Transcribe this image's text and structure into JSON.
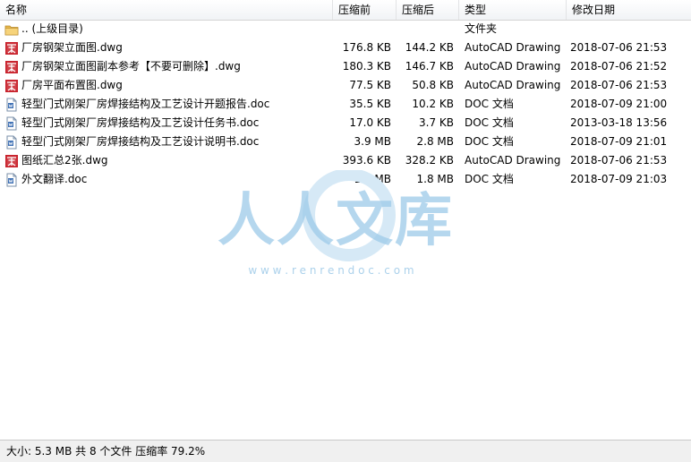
{
  "columns": {
    "name": "名称",
    "original_size": "压缩前",
    "compressed_size": "压缩后",
    "type": "类型",
    "modified": "修改日期"
  },
  "rows": [
    {
      "icon": "folder-icon",
      "name": ".. (上级目录)",
      "original": "",
      "compressed": "",
      "type": "文件夹",
      "date": ""
    },
    {
      "icon": "dwg-file-icon",
      "name": "厂房钢架立面图.dwg",
      "original": "176.8 KB",
      "compressed": "144.2 KB",
      "type": "AutoCAD Drawing",
      "date": "2018-07-06 21:53"
    },
    {
      "icon": "dwg-file-icon",
      "name": "厂房钢架立面图副本参考【不要可删除】.dwg",
      "original": "180.3 KB",
      "compressed": "146.7 KB",
      "type": "AutoCAD Drawing",
      "date": "2018-07-06 21:52"
    },
    {
      "icon": "dwg-file-icon",
      "name": "厂房平面布置图.dwg",
      "original": "77.5 KB",
      "compressed": "50.8 KB",
      "type": "AutoCAD Drawing",
      "date": "2018-07-06 21:53"
    },
    {
      "icon": "doc-file-icon",
      "name": "轻型门式刚架厂房焊接结构及工艺设计开题报告.doc",
      "original": "35.5 KB",
      "compressed": "10.2 KB",
      "type": "DOC 文档",
      "date": "2018-07-09 21:00"
    },
    {
      "icon": "doc-file-icon",
      "name": "轻型门式刚架厂房焊接结构及工艺设计任务书.doc",
      "original": "17.0 KB",
      "compressed": "3.7 KB",
      "type": "DOC 文档",
      "date": "2013-03-18 13:56"
    },
    {
      "icon": "doc-file-icon",
      "name": "轻型门式刚架厂房焊接结构及工艺设计说明书.doc",
      "original": "3.9 MB",
      "compressed": "2.8 MB",
      "type": "DOC 文档",
      "date": "2018-07-09 21:01"
    },
    {
      "icon": "dwg-file-icon",
      "name": "图纸汇总2张.dwg",
      "original": "393.6 KB",
      "compressed": "328.2 KB",
      "type": "AutoCAD Drawing",
      "date": "2018-07-06 21:53"
    },
    {
      "icon": "doc-file-icon",
      "name": "外文翻译.doc",
      "original": "1.9 MB",
      "compressed": "1.8 MB",
      "type": "DOC 文档",
      "date": "2018-07-09 21:03"
    }
  ],
  "watermark": {
    "title": "人人文库",
    "url": "w w w . r e n r e n d o c . c o m"
  },
  "status": {
    "text": "大小: 5.3 MB 共 8 个文件 压缩率 79.2%"
  },
  "colors": {
    "dwg_icon": "#c8202a",
    "folder_icon": "#e8b84a",
    "doc_icon": "#3d6fb4",
    "watermark": "#9cc9e8"
  }
}
